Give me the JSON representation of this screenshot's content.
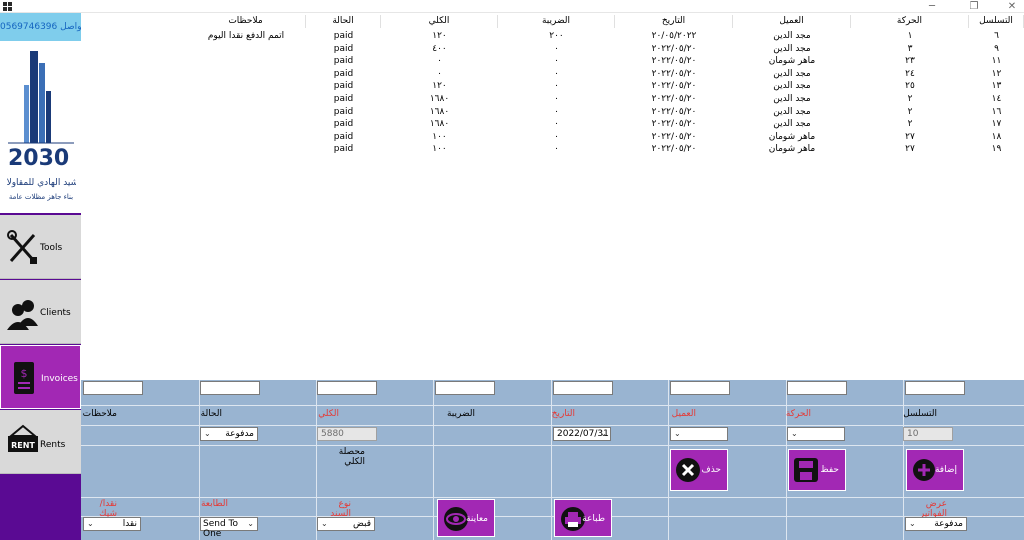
{
  "window": {
    "title": "",
    "minimize": "─",
    "restore": "❐",
    "close": "✕"
  },
  "sidebar": {
    "phone": "للتواصل 0569746396",
    "logo_text": "الشيد الهادي للمقاولات",
    "logo_sub": "بناء جاهز مظلات عامة",
    "logo_number": "2030",
    "items": [
      {
        "label": "Tools",
        "icon": "tools-icon"
      },
      {
        "label": "Clients",
        "icon": "clients-icon"
      },
      {
        "label": "Invoices",
        "icon": "invoice-icon"
      },
      {
        "label": "Rents",
        "icon": "rent-sign-icon",
        "badge": "RENT"
      }
    ]
  },
  "grid": {
    "columns": [
      "التسلسل",
      "الحركة",
      "العميل",
      "التاريخ",
      "الضريبة",
      "الكلي",
      "الحالة",
      "ملاحظات"
    ],
    "rows": [
      [
        "٦",
        "١",
        "مجد الدين",
        "٢٠/٠٥/٢٠٢٢",
        "٢٠٠",
        "١٢٠",
        "paid",
        "اتمم الدفع نقدا اليوم"
      ],
      [
        "٩",
        "٣",
        "مجد الدين",
        "٢٠٢٢/٠٥/٢٠",
        "٠",
        "٤٠٠",
        "paid",
        ""
      ],
      [
        "١١",
        "٢٣",
        "ماهر شومان",
        "٢٠٢٢/٠٥/٢٠",
        "٠",
        "٠",
        "paid",
        ""
      ],
      [
        "١٢",
        "٢٤",
        "مجد الدين",
        "٢٠٢٢/٠٥/٢٠",
        "٠",
        "٠",
        "paid",
        ""
      ],
      [
        "١٣",
        "٢٥",
        "مجد الدين",
        "٢٠٢٢/٠٥/٢٠",
        "٠",
        "١٢٠",
        "paid",
        ""
      ],
      [
        "١٤",
        "٢",
        "مجد الدين",
        "٢٠٢٢/٠٥/٢٠",
        "٠",
        "١٦٨٠",
        "paid",
        ""
      ],
      [
        "١٦",
        "٢",
        "مجد الدين",
        "٢٠٢٢/٠٥/٢٠",
        "٠",
        "١٦٨٠",
        "paid",
        ""
      ],
      [
        "١٧",
        "٢",
        "مجد الدين",
        "٢٠٢٢/٠٥/٢٠",
        "٠",
        "١٦٨٠",
        "paid",
        ""
      ],
      [
        "١٨",
        "٢٧",
        "ماهر شومان",
        "٢٠٢٢/٠٥/٢٠",
        "٠",
        "١٠٠",
        "paid",
        ""
      ],
      [
        "١٩",
        "٢٧",
        "ماهر شومان",
        "٢٠٢٢/٠٥/٢٠",
        "٠",
        "١٠٠",
        "paid",
        ""
      ]
    ]
  },
  "form": {
    "labels": {
      "serial": "التسلسل",
      "movement": "الحركة",
      "client": "العميل",
      "date": "التاريخ",
      "tax": "الضريبة",
      "total": "الكلي",
      "status": "الحالة",
      "notes": "ملاحظات",
      "total_collected": "محصلة الكلي",
      "show_invoices": "عرض الفواتير",
      "voucher_type": "نوع السند",
      "printer": "الطابعة",
      "payment_method": "نقدا/شيك"
    },
    "values": {
      "serial": "10",
      "movement": "",
      "client": "",
      "date": "2022/07/31",
      "tax": "",
      "total": "5880",
      "status": "مدفوعة",
      "show_invoices": "مدفوعة",
      "voucher_type": "قبض",
      "printer": "Send To One",
      "payment_method": "نقدا"
    },
    "buttons": {
      "add": "إضافة",
      "save": "حفظ",
      "delete": "حذف",
      "print": "طباعة",
      "preview": "معاينة"
    }
  }
}
